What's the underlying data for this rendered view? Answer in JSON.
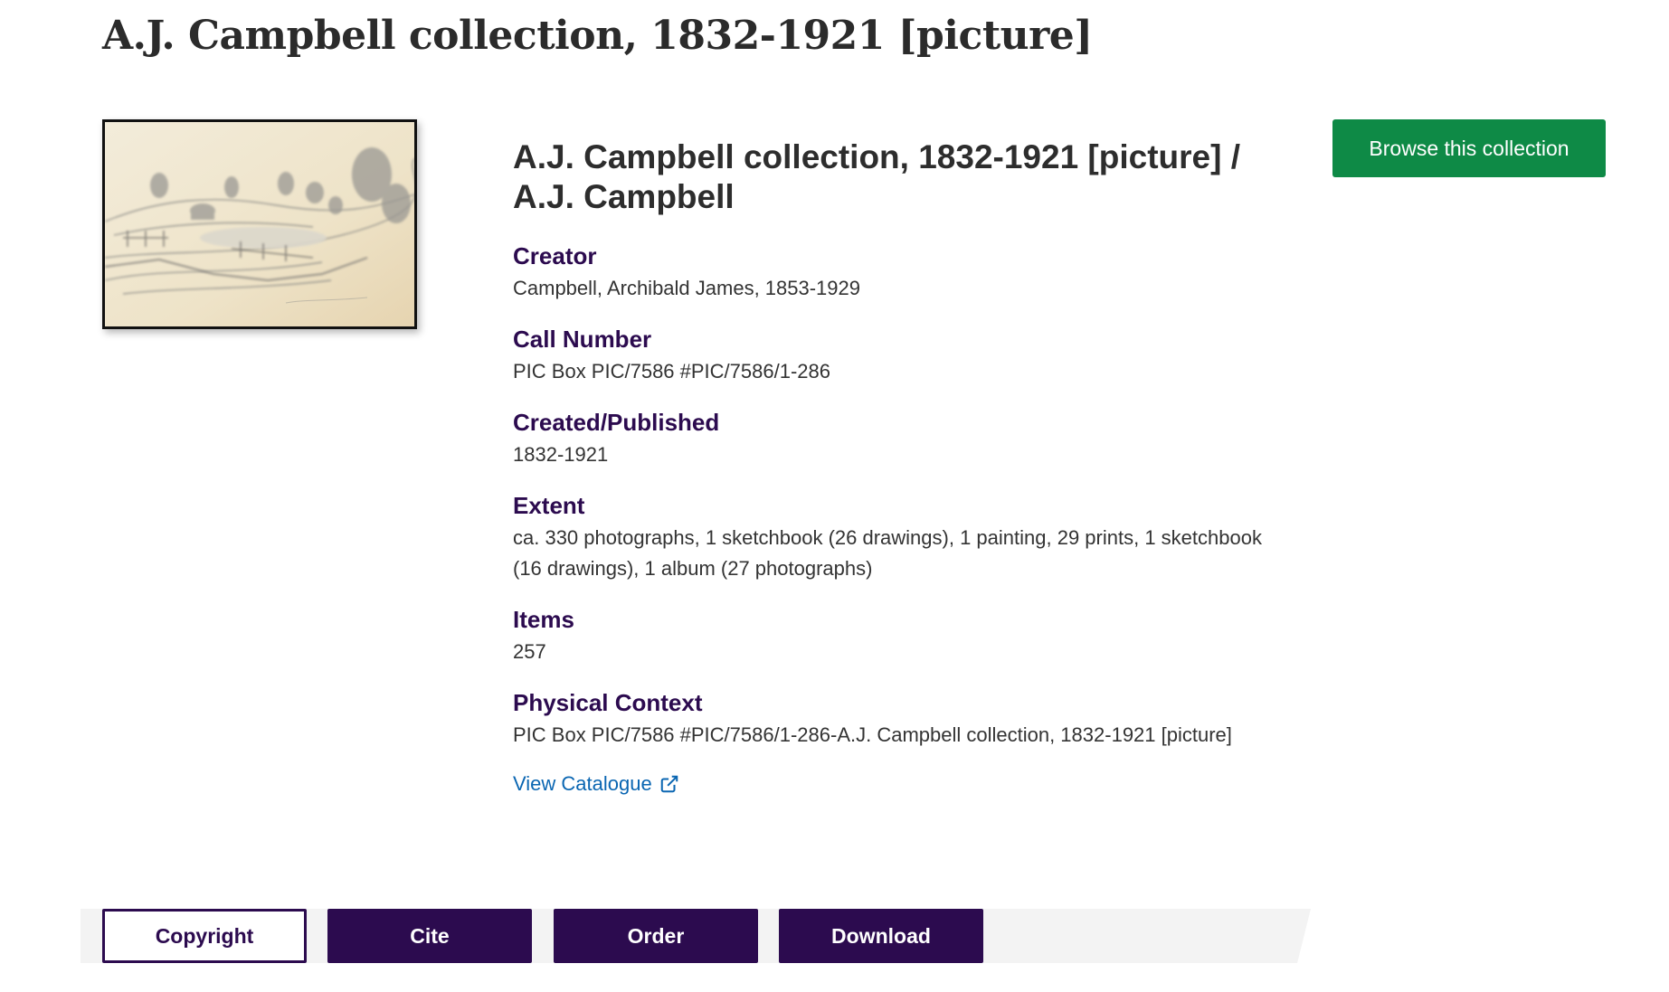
{
  "page": {
    "title": "A.J. Campbell collection, 1832-1921 [picture]"
  },
  "thumbnail": {
    "alt": "Pencil sketch of a landscape with a pond, trees and huts"
  },
  "record": {
    "title": "A.J. Campbell collection, 1832-1921 [picture] / A.J. Campbell",
    "fields": [
      {
        "label": "Creator",
        "value": "Campbell, Archibald James, 1853-1929"
      },
      {
        "label": "Call Number",
        "value": "PIC Box PIC/7586 #PIC/7586/1-286"
      },
      {
        "label": "Created/Published",
        "value": "1832-1921"
      },
      {
        "label": "Extent",
        "value": "ca. 330 photographs, 1 sketchbook (26 drawings), 1 painting, 29 prints, 1 sketchbook (16 drawings), 1 album (27 photographs)"
      },
      {
        "label": "Items",
        "value": "257"
      },
      {
        "label": "Physical Context",
        "value": "PIC Box PIC/7586 #PIC/7586/1-286-A.J. Campbell collection, 1832-1921 [picture]"
      }
    ],
    "catalogue_link": "View Catalogue",
    "catalogue_icon": "external-link-icon"
  },
  "browse_button": "Browse this collection",
  "actions": {
    "copyright": "Copyright",
    "cite": "Cite",
    "order": "Order",
    "download": "Download"
  },
  "colors": {
    "label_purple": "#2c0b4f",
    "browse_green": "#0e8a46",
    "link_blue": "#0a66b2"
  }
}
